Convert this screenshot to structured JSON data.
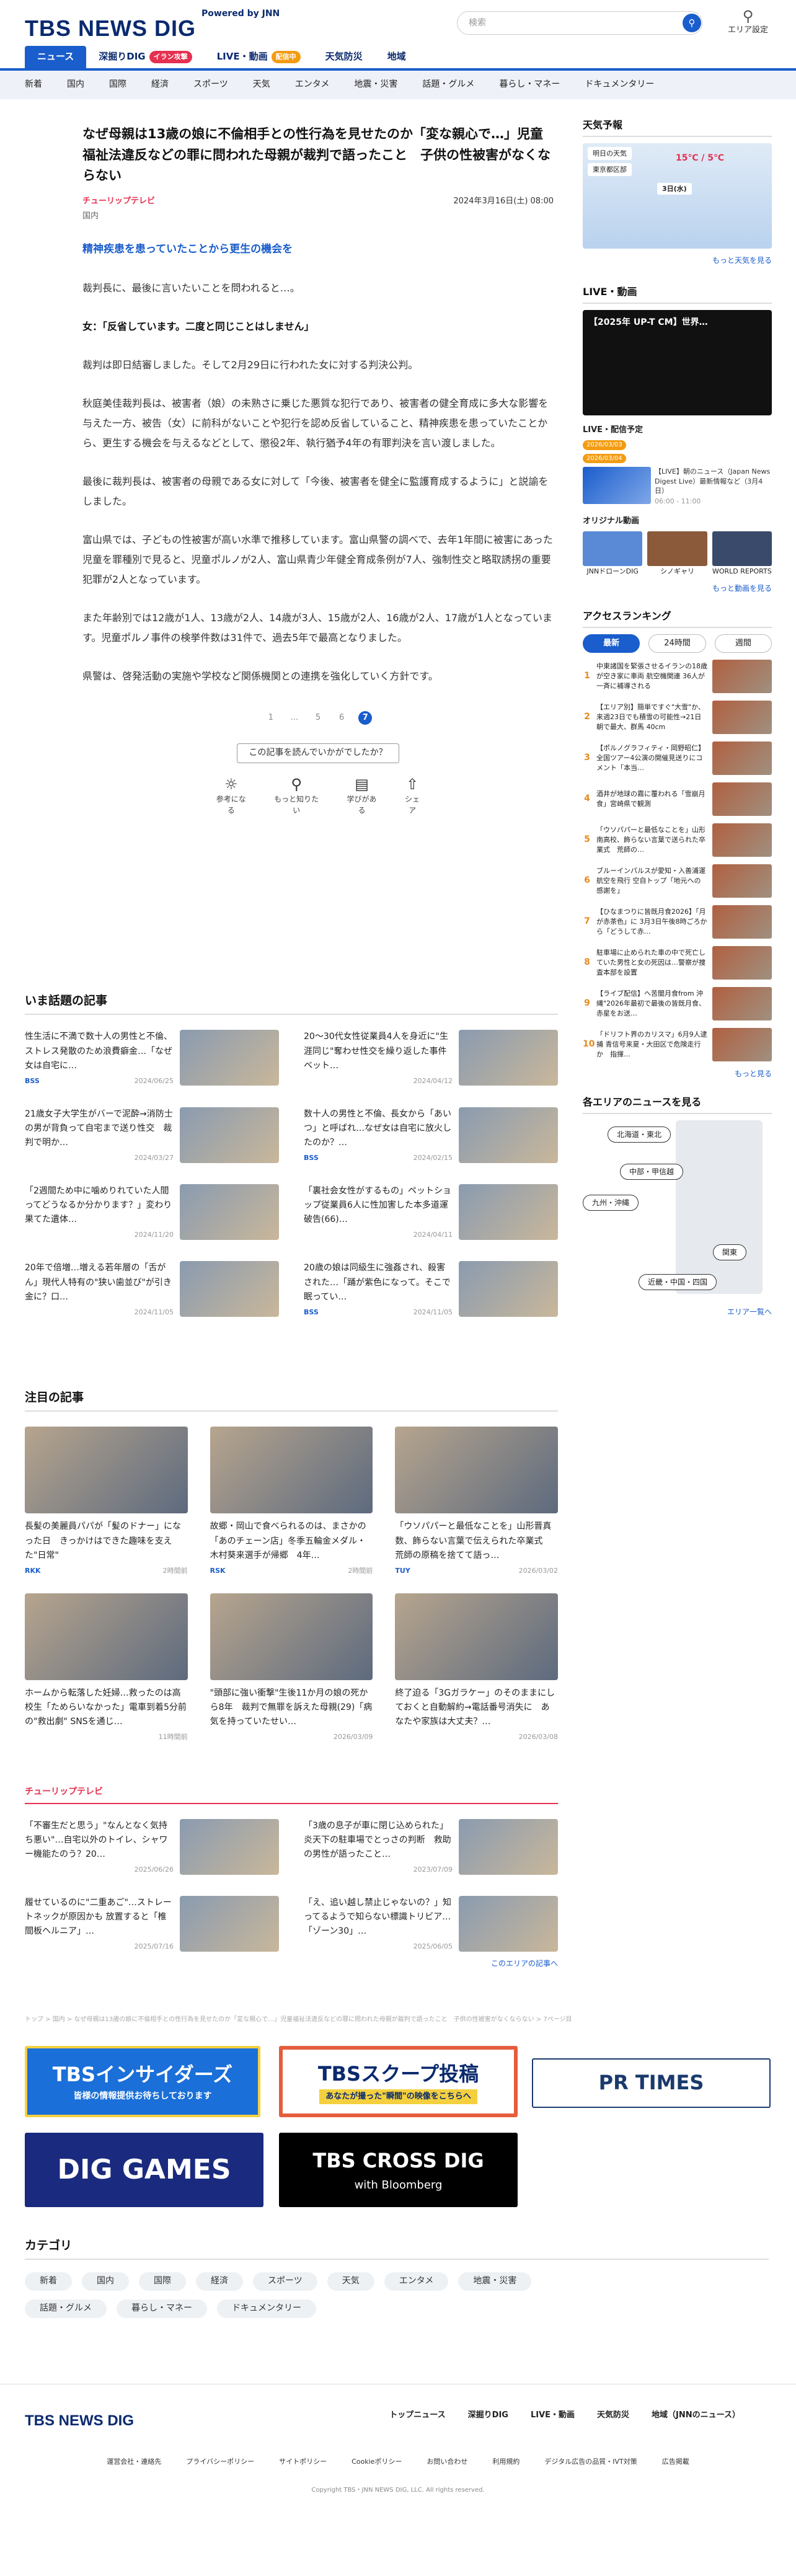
{
  "header": {
    "logo": "TBS NEWS DIG",
    "powered": "Powered by JNN",
    "search_placeholder": "検索",
    "area_label": "エリア設定"
  },
  "mainnav": [
    {
      "label": "ニュース",
      "badge": ""
    },
    {
      "label": "深掘りDIG",
      "badge": "イラン攻撃"
    },
    {
      "label": "LIVE・動画",
      "badge": "配信中"
    },
    {
      "label": "天気防災",
      "badge": ""
    },
    {
      "label": "地域",
      "badge": ""
    }
  ],
  "subnav": [
    "新着",
    "国内",
    "国際",
    "経済",
    "スポーツ",
    "天気",
    "エンタメ",
    "地震・災害",
    "話題・グルメ",
    "暮らし・マネー",
    "ドキュメンタリー"
  ],
  "article": {
    "title": "なぜ母親は13歳の娘に不倫相手との性行為を見せたのか「変な親心で…」児童福祉法違反などの罪に問われた母親が裁判で語ったこと　子供の性被害がなくならない",
    "source": "チューリップテレビ",
    "date": "2024年3月16日(土) 08:00",
    "category": "国内",
    "lead": "精神疾患を患っていたことから更生の機会を",
    "p1": "裁判長に、最後に言いたいことを問われると…。",
    "p2": "女：「反省しています。二度と同じことはしません」",
    "p3": "裁判は即日結審しました。そして2月29日に行われた女に対する判決公判。",
    "p4": "秋庭美佳裁判長は、被害者（娘）の未熟さに乗じた悪質な犯行であり、被害者の健全育成に多大な影響を与えた一方、被告（女）に前科がないことや犯行を認め反省していること、精神疾患を患っていたことから、更生する機会を与えるなどとして、懲役2年、執行猶予4年の有罪判決を言い渡しました。",
    "p5": "最後に裁判長は、被害者の母親である女に対して「今後、被害者を健全に監護育成するように」と説諭をしました。",
    "p6": "富山県では、子どもの性被害が高い水準で推移しています。富山県警の調べで、去年1年間に被害にあった児童を罪種別で見ると、児童ポルノが2人、富山県青少年健全育成条例が7人、強制性交と略取誘拐の重要犯罪が2人となっています。",
    "p7": "また年齢別では12歳が1人、13歳が2人、14歳が3人、15歳が2人、16歳が2人、17歳が1人となっています。児童ポルノ事件の検挙件数は31件で、過去5年で最高となりました。",
    "p8": "県警は、啓発活動の実施や学校など関係機関との連携を強化していく方針です。",
    "pages": [
      "1",
      "...",
      "5",
      "6",
      "7"
    ],
    "survey_q": "この記事を読んでいかがでしたか？",
    "reactions": [
      "参考になる",
      "もっと知りたい",
      "学びがある",
      "シェア"
    ]
  },
  "hot": {
    "heading": "いま話題の記事",
    "items": [
      {
        "title": "性生活に不満で数十人の男性と不倫、ストレス発散のため浪費癖金…「なぜ女は自宅に…",
        "src": "BSS",
        "date": "2024/06/25"
      },
      {
        "title": "20〜30代女性従業員4人を身近に\"生涯同じ\"奪わせ性交を繰り返した事件　ベット…",
        "src": "",
        "date": "2024/04/12"
      },
      {
        "title": "21歳女子大学生がバーで泥酔→消防士の男が背負って自宅まで送り性交　裁判で明か…",
        "src": "",
        "date": "2024/03/27"
      },
      {
        "title": "数十人の男性と不倫、長女から「あいつ」と呼ばれ…なぜ女は自宅に放火したのか？…",
        "src": "BSS",
        "date": "2024/02/15"
      },
      {
        "title": "「2週間ため中に噛めりれていた人間ってどうなるか分かります？」変わり果てた遺体…",
        "src": "",
        "date": "2024/11/20"
      },
      {
        "title": "「裏社会女性がするもの」ペットショップ従業員6人に性加害した本多道運破告(66)…",
        "src": "",
        "date": "2024/04/11"
      },
      {
        "title": "20年で倍増…増える若年層の「舌がん」現代人特有の\"狭い歯並び\"が引き金に？口…",
        "src": "",
        "date": "2024/11/05"
      },
      {
        "title": "20歳の娘は同級生に強姦され、殺害された…「踊が紫色になって。そこで眠ってい…",
        "src": "BSS",
        "date": "2024/11/05"
      }
    ]
  },
  "attention": {
    "heading": "注目の記事",
    "items": [
      {
        "title": "長髪の美麗員パパが「髪のドナー」になった日　きっかけはできた趣味を支えた\"日常\"",
        "src": "RKK",
        "date": "2時間前"
      },
      {
        "title": "故郷・岡山で食べられるのは、まさかの「あのチェーン店」冬季五輪金メダル・木村葵来選手が帰郷　4年…",
        "src": "RSK",
        "date": "2時間前"
      },
      {
        "title": "「ウソパパーと最低なことを」山形晋真数、飾らない言葉で伝えられた卒業式　荒師の原稿を捨てて語っ…",
        "src": "TUY",
        "date": "2026/03/02"
      },
      {
        "title": "ホームから転落した妊婦…救ったのは高校生「ためらいなかった」電車到着5分前の\"救出劇\" SNSを通じ…",
        "src": "",
        "date": "11時間前"
      },
      {
        "title": "\"頭部に強い衝撃\"生後11か月の娘の死から8年　裁判で無罪を訴えた母親(29)「病気を持っていたせい…",
        "src": "",
        "date": "2026/03/09"
      },
      {
        "title": "終了迫る「3Gガラケー」のそのままにしておくと自動解約→電話番号消失に　あなたや家族は大丈夫？…",
        "src": "",
        "date": "2026/03/08"
      }
    ]
  },
  "tulip": {
    "brand": "チューリップテレビ",
    "items": [
      {
        "title": "「不審生だと思う」\"なんとなく気持ち悪い\"…自宅以外のトイレ、シャワー機能たのう？20…",
        "date": "2025/06/26"
      },
      {
        "title": "「3歳の息子が車に閉じ込められた」炎天下の駐車場でとっさの判断　救助の男性が語ったこと…",
        "date": "2023/07/09"
      },
      {
        "title": "履せているのに\"二重あご\"…ストレートネックが原因かも 放置すると「椎間板ヘルニア」…",
        "date": "2025/07/16"
      },
      {
        "title": "「え、追い越し禁止じゃないの？」知ってるようで知らない標識トリビア…「ゾーン30」…",
        "date": "2025/06/05"
      }
    ],
    "more": "このエリアの記事へ"
  },
  "breadcrumb": "トップ > 国内 > なぜ母親は13歳の娘に不倫相手との性行為を見せたのか「変な親心で…」児童福祉法違反などの罪に問われた母親が裁判で語ったこと　子供の性被害がなくならない > 7ページ目",
  "banners": {
    "insiders": "TBSインサイダーズ",
    "insiders_sub": "皆様の情報提供お待ちしております",
    "scoop": "TBSスクープ投稿",
    "scoop_sub": "あなたが撮った\"瞬間\"の映像をこちらへ",
    "prtimes": "PR TIMES",
    "diggames": "DIG GAMES",
    "crossdig": "TBS CROSS DIG",
    "crossdig_sub": "with Bloomberg"
  },
  "category_section": {
    "heading": "カテゴリ",
    "tags": [
      "新着",
      "国内",
      "国際",
      "経済",
      "スポーツ",
      "天気",
      "エンタメ",
      "地震・災害",
      "話題・グルメ",
      "暮らし・マネー",
      "ドキュメンタリー"
    ]
  },
  "sidebar": {
    "weather_heading": "天気予報",
    "weather_tomorrow": "明日の天気",
    "weather_area": "東京都区部",
    "weather_temp": "15℃ / 5℃",
    "weather_date": "3日(水)",
    "weather_more": "もっと天気を見る",
    "live_heading": "LIVE・動画",
    "live_video_title": "【2025年 UP-T CM】世界…",
    "schedule_heading": "LIVE・配信予定",
    "schedule_dates": [
      "2026/03/03",
      "2026/03/04"
    ],
    "schedule_item": "【LIVE】朝のニュース（Japan News Digest Live）最新情報など（3月4日）",
    "schedule_time": "06:00 - 11:00",
    "orig_heading": "オリジナル動画",
    "orig_items": [
      "JNNドローンDIG",
      "シノギャリ",
      "WORLD REPORTS"
    ],
    "orig_more": "もっと動画を見る",
    "rank_heading": "アクセスランキング",
    "rank_tabs": [
      "最新",
      "24時間",
      "週間"
    ],
    "ranks": [
      "中東諸国を緊張させるイランの18歳が空き家に車両 航空機関連 36人が一斉に補導される",
      "【エリア別】簡単ですぐ\"大雪\"か、来週23日でも積雪の可能性→21日朝で最大、群馬 40cm",
      "【ポルノグラフィティ・岡野昭仁】全国ツアー4公演の開催見送りにコメント「本当…",
      "酒井が地球の霧に覆われる「雪崩月食」宮崎県で観測",
      "「ウソパパーと最低なことを」山形南高校、飾らない言葉で送られた卒業式　荒師の…",
      "ブルーインパルスが愛知・入善浦運航空を飛行 空自トップ「地元への感謝を」",
      "【ひなまつりに皆既月食2026】「月が赤茶色」に 3月3日午後8時ごろから「どうして赤…",
      "駐車場に止められた車の中で死亡していた男性と女の死因は…警察が捜査本部を設置",
      "【ライブ配信】ヘ苦闇月食from 沖縄\"2026年最初で最後の皆既月食、赤星をお送…",
      "「ドリフト界のカリスマ」6月9人逮捕 青信号来夏・大田区で危険走行か　指揮…"
    ],
    "rank_more": "もっと見る",
    "area_heading": "各エリアのニュースを見る",
    "regions": [
      "北海道・東北",
      "中部・甲信越",
      "九州・沖縄",
      "関東",
      "近畿・中国・四国"
    ],
    "area_more": "エリア一覧へ"
  },
  "footer": {
    "logo": "TBS NEWS DIG",
    "links": [
      "トップニュース",
      "深掘りDIG",
      "LIVE・動画",
      "天気防災",
      "地域（JNNのニュース）"
    ],
    "sublinks": [
      "運営会社・連絡先",
      "プライバシーポリシー",
      "サイトポリシー",
      "Cookieポリシー",
      "お問い合わせ",
      "利用規約",
      "デジタル広告の品質・IVT対策",
      "広告掲載"
    ],
    "copyright": "Copyright TBS・JNN NEWS DIG, LLC. All rights reserved."
  }
}
